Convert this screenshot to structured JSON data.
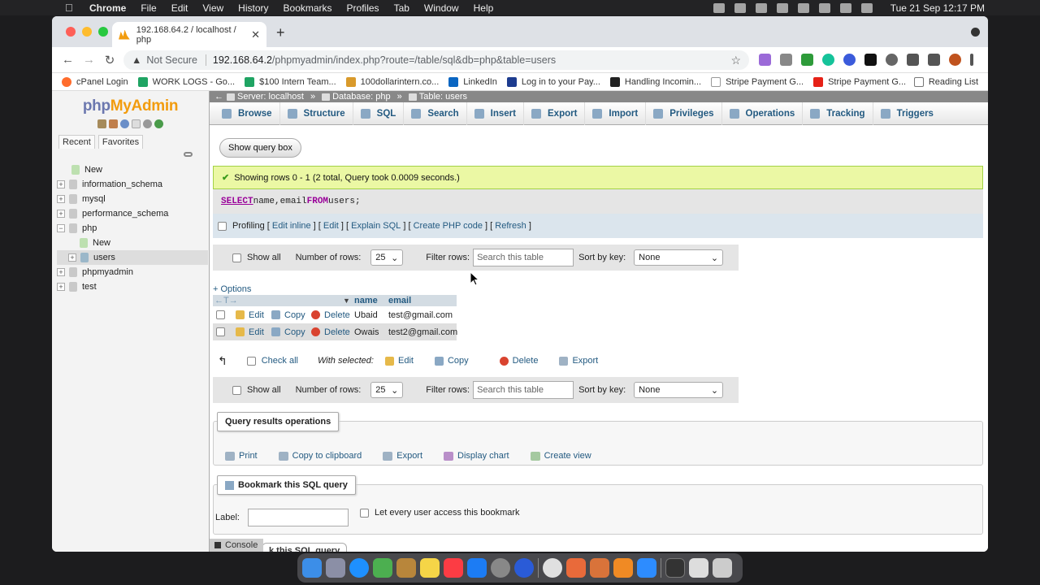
{
  "menubar": {
    "app": "Chrome",
    "items": [
      "File",
      "Edit",
      "View",
      "History",
      "Bookmarks",
      "Profiles",
      "Tab",
      "Window",
      "Help"
    ],
    "clock": "Tue 21 Sep  12:17 PM"
  },
  "browser": {
    "tab_title": "192.168.64.2 / localhost / php",
    "security": "Not Secure",
    "url_host": "192.168.64.2",
    "url_path": "/phpmyadmin/index.php?route=/table/sql&db=php&table=users",
    "bookmarks": [
      "cPanel Login",
      "WORK LOGS - Go...",
      "$100 Intern Team...",
      "100dollarintern.co...",
      "LinkedIn",
      "Log in to your Pay...",
      "Handling Incomin...",
      "Stripe Payment G...",
      "Stripe Payment G..."
    ],
    "reading_list": "Reading List"
  },
  "sidebar": {
    "logo_a": "php",
    "logo_b": "MyAdmin",
    "tabs": [
      "Recent",
      "Favorites"
    ],
    "tree": [
      {
        "label": "New"
      },
      {
        "label": "information_schema"
      },
      {
        "label": "mysql"
      },
      {
        "label": "performance_schema"
      },
      {
        "label": "php"
      },
      {
        "label": "New"
      },
      {
        "label": "users"
      },
      {
        "label": "phpmyadmin"
      },
      {
        "label": "test"
      }
    ]
  },
  "breadcrumb": {
    "server": "Server: localhost",
    "database": "Database: php",
    "table": "Table: users"
  },
  "tabs": [
    "Browse",
    "Structure",
    "SQL",
    "Search",
    "Insert",
    "Export",
    "Import",
    "Privileges",
    "Operations",
    "Tracking",
    "Triggers"
  ],
  "query": {
    "show_query_box": "Show query box",
    "success": "Showing rows 0 - 1 (2 total, Query took 0.0009 seconds.)",
    "sql_select": "SELECT",
    "sql_mid": " name,email ",
    "sql_from": "FROM",
    "sql_end": " users;",
    "profiling": "Profiling",
    "links": [
      "Edit inline",
      "Edit",
      "Explain SQL",
      "Create PHP code",
      "Refresh"
    ]
  },
  "navbar": {
    "show_all": "Show all",
    "num_rows_label": "Number of rows:",
    "num_rows": "25",
    "filter_label": "Filter rows:",
    "filter_placeholder": "Search this table",
    "sort_label": "Sort by key:",
    "sort_value": "None"
  },
  "options": "+ Options",
  "table": {
    "columns": [
      "name",
      "email"
    ],
    "actions": [
      "Edit",
      "Copy",
      "Delete"
    ],
    "rows": [
      {
        "name": "Ubaid",
        "email": "test@gmail.com"
      },
      {
        "name": "Owais",
        "email": "test2@gmail.com"
      }
    ]
  },
  "with_selected": {
    "check_all": "Check all",
    "label": "With selected:",
    "actions": [
      "Edit",
      "Copy",
      "Delete",
      "Export"
    ]
  },
  "qro": {
    "title": "Query results operations",
    "ops": [
      "Print",
      "Copy to clipboard",
      "Export",
      "Display chart",
      "Create view"
    ]
  },
  "bookmark": {
    "title": "Bookmark this SQL query",
    "label": "Label:",
    "public": "Let every user access this bookmark",
    "footer_partial": "k this SQL query"
  },
  "console": "Console"
}
